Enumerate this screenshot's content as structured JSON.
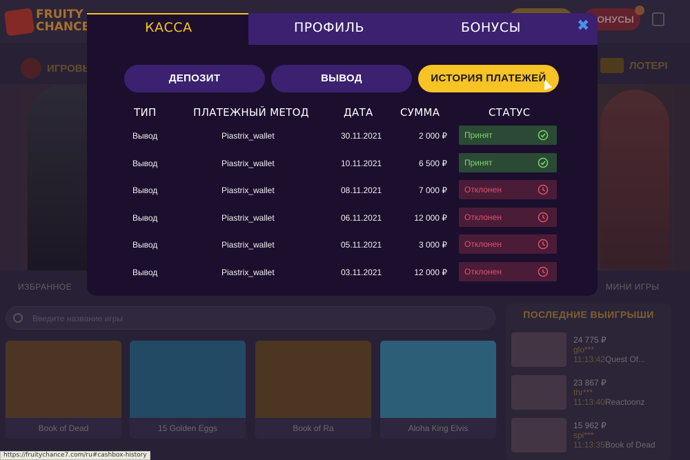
{
  "site": {
    "logo_text": "FRUITY CHANCE",
    "header_bonus_btn": "БОНУСЫ",
    "nav_games": "ИГРОВЫ",
    "nav_lottery": "ЛОТЕРІ",
    "fav_label": "ИЗБРАННОЕ",
    "mini_label": "МИНИ ИГРЫ",
    "search_placeholder": "Введите название игры",
    "last_wins_title": "ПОСЛЕДНИЕ ВЫИГРЫШИ",
    "games": [
      {
        "name": "Book of Dead",
        "color": "#6a4a2a"
      },
      {
        "name": "15 Golden Eggs",
        "color": "#2a6a8a"
      },
      {
        "name": "Book of Ra",
        "color": "#6a4a24"
      },
      {
        "name": "Aloha King Elvis",
        "color": "#3a8aa8"
      }
    ],
    "wins": [
      {
        "amount": "24 775 ₽",
        "user": "glo***",
        "time": "11:13:42",
        "game": "Quest Of..."
      },
      {
        "amount": "23 867 ₽",
        "user": "thr***",
        "time": "11:13:40",
        "game": "Reactoonz"
      },
      {
        "amount": "15 962 ₽",
        "user": "spi***",
        "time": "11:13:35",
        "game": "Book of Dead"
      }
    ],
    "status_url": "https://fruitychance7.com/ru#cashbox-history"
  },
  "modal": {
    "tabs": [
      "КАССА",
      "ПРОФИЛЬ",
      "БОНУСЫ"
    ],
    "active_tab": "КАССА",
    "close_icon": "close-icon",
    "buttons": {
      "deposit": "ДЕПОЗИТ",
      "withdraw": "ВЫВОД",
      "history": "ИСТОРИЯ ПЛАТЕЖЕЙ"
    },
    "columns": {
      "type": "ТИП",
      "method": "ПЛАТЕЖНЫЙ МЕТОД",
      "date": "ДАТА",
      "sum": "СУММА",
      "status": "СТАТУС"
    },
    "rows": [
      {
        "type": "Вывод",
        "method": "Piastrix_wallet",
        "date": "30.11.2021",
        "sum": "2 000 ₽",
        "status": "Принят",
        "state": "ok"
      },
      {
        "type": "Вывод",
        "method": "Piastrix_wallet",
        "date": "10.11.2021",
        "sum": "6 500 ₽",
        "status": "Принят",
        "state": "ok"
      },
      {
        "type": "Вывод",
        "method": "Piastrix_wallet",
        "date": "08.11.2021",
        "sum": "7 000 ₽",
        "status": "Отклонен",
        "state": "bad"
      },
      {
        "type": "Вывод",
        "method": "Piastrix_wallet",
        "date": "06.11.2021",
        "sum": "12 000 ₽",
        "status": "Отклонен",
        "state": "bad"
      },
      {
        "type": "Вывод",
        "method": "Piastrix_wallet",
        "date": "05.11.2021",
        "sum": "3 000 ₽",
        "status": "Отклонен",
        "state": "bad"
      },
      {
        "type": "Вывод",
        "method": "Piastrix_wallet",
        "date": "03.11.2021",
        "sum": "12 000 ₽",
        "status": "Отклонен",
        "state": "bad"
      }
    ],
    "colors": {
      "accent": "#f7c325",
      "tab_bg": "#3b2170",
      "ok": "#7ed36a",
      "bad": "#e0516a"
    }
  }
}
